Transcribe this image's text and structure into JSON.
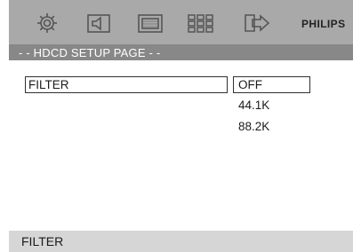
{
  "header": {
    "icons": [
      "gear-icon",
      "speaker-icon",
      "screen-icon",
      "grid-icon",
      "exit-arrow-icon"
    ],
    "brand": "PHILIPS"
  },
  "page": {
    "title": "- - HDCD SETUP PAGE - -"
  },
  "menu": {
    "item_label": "FILTER"
  },
  "options": {
    "items": [
      "OFF",
      "44.1K",
      "88.2K"
    ],
    "selected": "OFF"
  },
  "status": {
    "text": "FILTER"
  },
  "colors": {
    "topbar": "#a9a9a9",
    "subbar": "#888888",
    "bottombar": "#d6d6d6"
  }
}
